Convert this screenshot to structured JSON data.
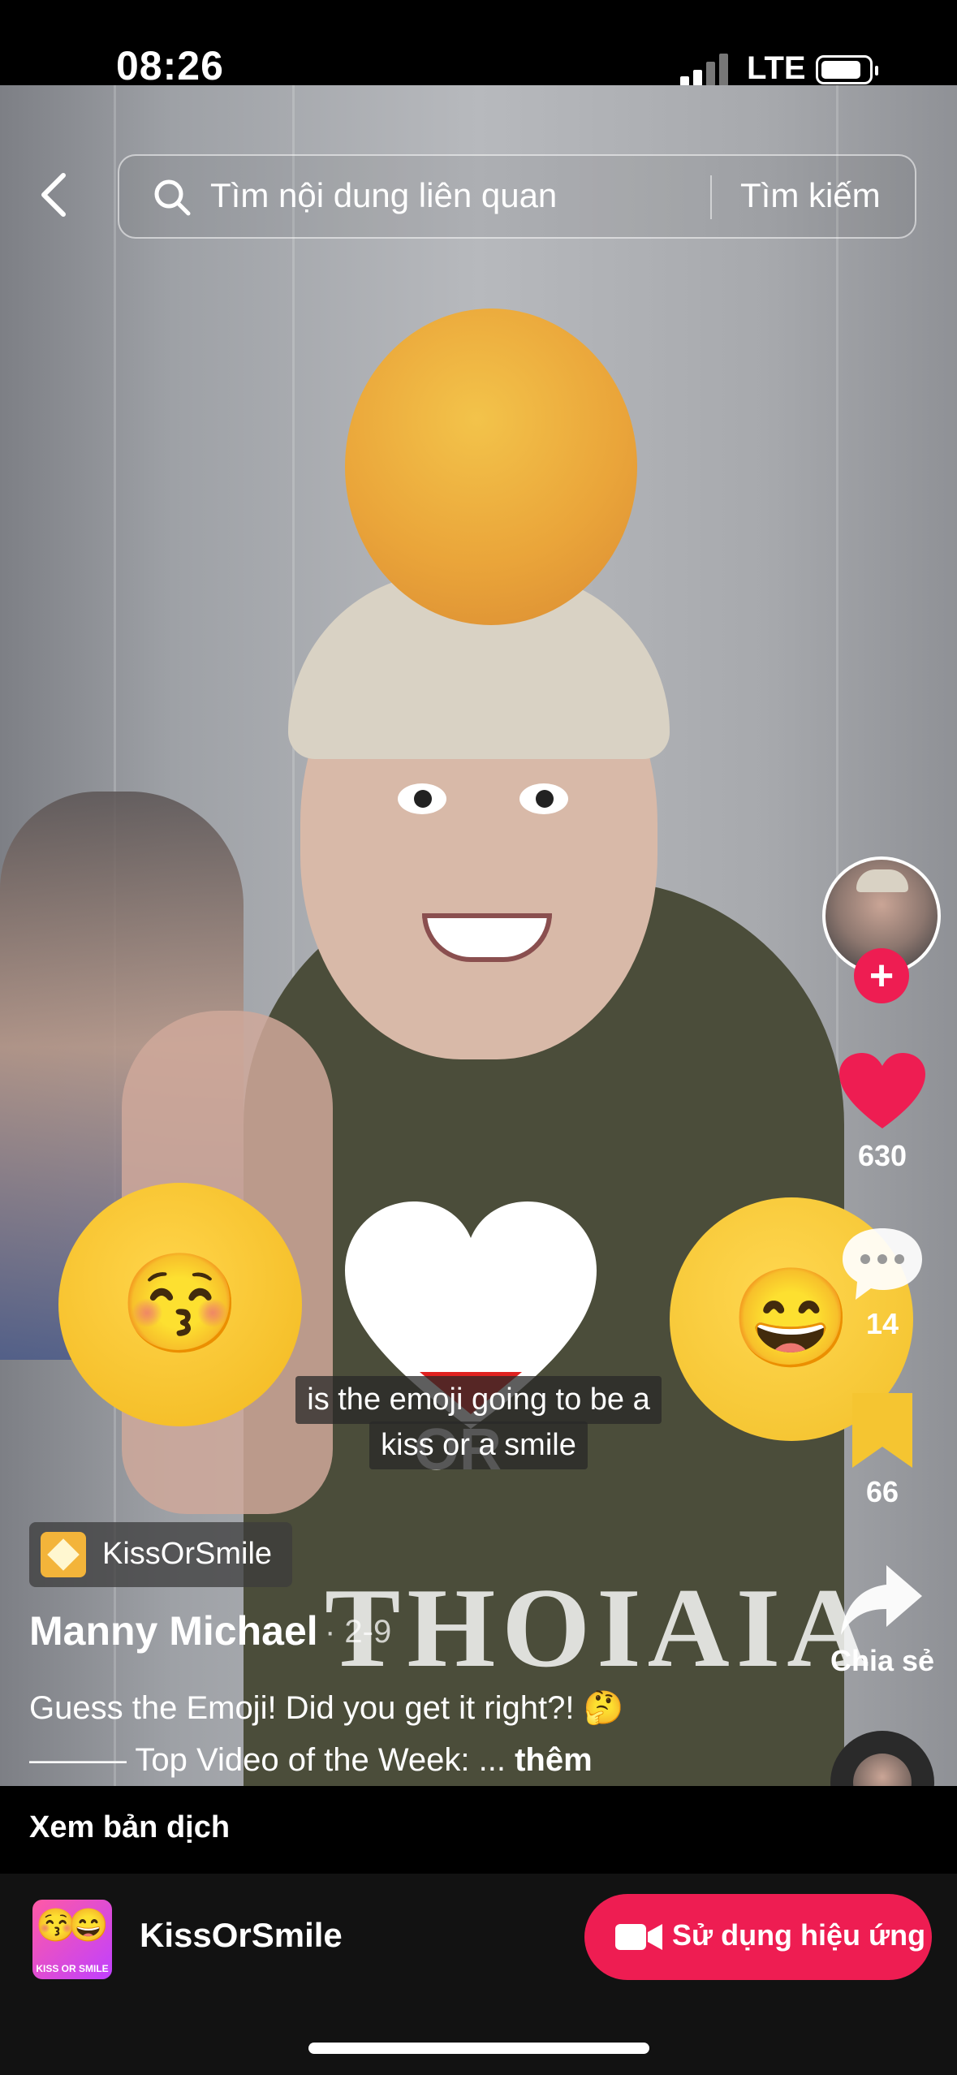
{
  "status_bar": {
    "time": "08:26",
    "network": "LTE"
  },
  "search": {
    "placeholder": "Tìm nội dung liên quan",
    "button": "Tìm kiếm"
  },
  "video": {
    "overlay_word": "OR",
    "caption_line1": "is the emoji going to be a",
    "caption_line2": "kiss or a smile",
    "shirt_text": "THOIAIA"
  },
  "actions": {
    "likes": "630",
    "comments": "14",
    "saves": "66",
    "share_label": "Chia sẻ"
  },
  "info": {
    "effect_chip": "KissOrSmile",
    "username": "Manny Michael",
    "date": "· 2-9",
    "description_line1": "Guess the Emoji! Did you get it right?! 🤔",
    "description_line2": "——— Top Video of the Week: ...",
    "more": "thêm"
  },
  "translate": {
    "label": "Xem bản dịch"
  },
  "effect_bar": {
    "name": "KissOrSmile",
    "thumb_text": "KISS OR SMILE",
    "use_button": "Sử dụng hiệu ứng"
  },
  "colors": {
    "accent": "#ee1d52",
    "like": "#ee1d52",
    "save": "#f5c531"
  }
}
